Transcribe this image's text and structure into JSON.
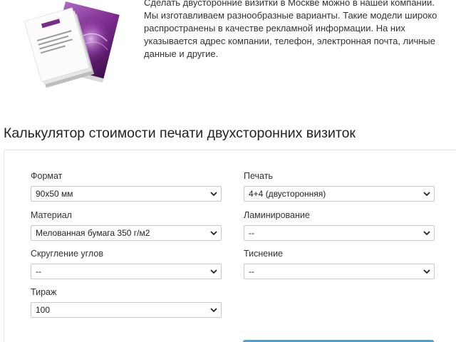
{
  "intro": {
    "text": "Сделать двусторонние визитки в Москве можно в нашей компании. Мы изготавливаем разнообразные варианты. Такие модели широко распространены в качестве рекламной информации. На них указывается адрес компании, телефон, электронная почта, личные данные и другие."
  },
  "calculator": {
    "title": "Калькулятор стоимости печати двухсторонних визиток",
    "fields": {
      "format": {
        "label": "Формат",
        "value": "90х50 мм"
      },
      "print": {
        "label": "Печать",
        "value": "4+4 (двусторонняя)"
      },
      "material": {
        "label": "Материал",
        "value": "Мелованная бумага 350 г/м2"
      },
      "lamination": {
        "label": "Ламинирование",
        "value": "--"
      },
      "rounding": {
        "label": "Скругление углов",
        "value": "--"
      },
      "embossing": {
        "label": "Тиснение",
        "value": "--"
      },
      "quantity": {
        "label": "Тираж",
        "value": "100"
      }
    }
  },
  "colors": {
    "card_purple": "#7a2a8c",
    "accent_blue": "#4a9fd6",
    "border": "#c9c9c9"
  },
  "icons": {
    "select_arrow": "chevron-down-icon"
  }
}
